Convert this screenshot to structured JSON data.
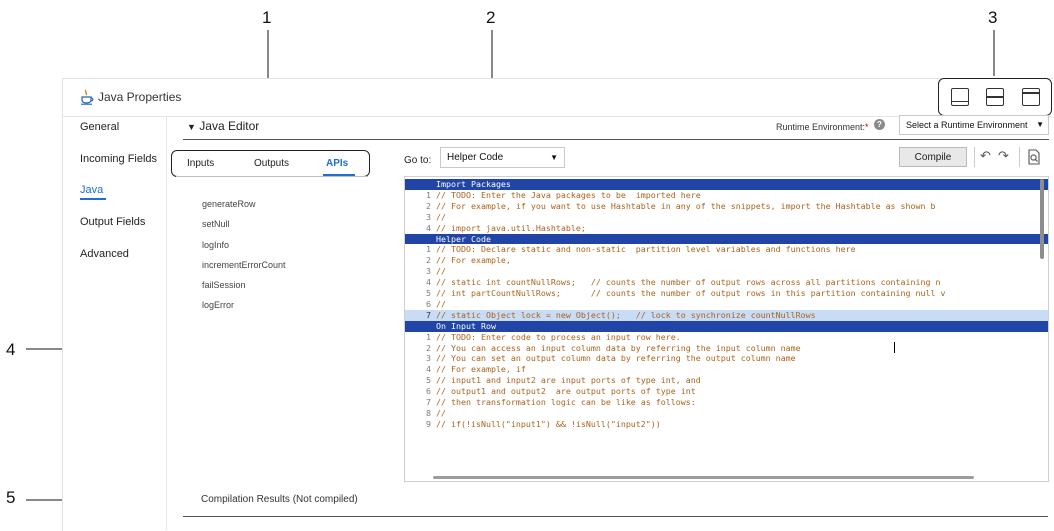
{
  "callouts": [
    "1",
    "2",
    "3",
    "4",
    "5"
  ],
  "window": {
    "title": "Java Properties",
    "icon": "java-cup-icon"
  },
  "layout_buttons": [
    "layout-bottom-icon",
    "layout-split-icon",
    "layout-top-icon"
  ],
  "sidebar": {
    "items": [
      {
        "label": "General",
        "active": false
      },
      {
        "label": "Incoming Fields",
        "active": false
      },
      {
        "label": "Java",
        "active": true
      },
      {
        "label": "Output Fields",
        "active": false
      },
      {
        "label": "Advanced",
        "active": false
      }
    ]
  },
  "editor_section": {
    "title": "Java Editor",
    "expanded_icon": "triangle-down-icon"
  },
  "runtime": {
    "label": "Runtime Environment:",
    "required_mark": "*",
    "select_value": "Select a Runtime Environment"
  },
  "tabs": [
    {
      "label": "Inputs",
      "active": false
    },
    {
      "label": "Outputs",
      "active": false
    },
    {
      "label": "APIs",
      "active": true
    }
  ],
  "api_items": [
    "generateRow",
    "setNull",
    "logInfo",
    "incrementErrorCount",
    "failSession",
    "logError"
  ],
  "goto": {
    "label": "Go to:",
    "value": "Helper Code"
  },
  "toolbar": {
    "compile_label": "Compile",
    "undo_icon": "undo-icon",
    "redo_icon": "redo-icon",
    "find_icon": "find-icon"
  },
  "code_lines": [
    {
      "n": "",
      "text": "Import Packages",
      "type": "hdr"
    },
    {
      "n": "1",
      "text": "// TODO: Enter the Java packages to be  imported here",
      "type": "code"
    },
    {
      "n": "2",
      "text": "// For example, if you want to use Hashtable in any of the snippets, import the Hashtable as shown b",
      "type": "code"
    },
    {
      "n": "3",
      "text": "//",
      "type": "code"
    },
    {
      "n": "4",
      "text": "// import java.util.Hashtable;",
      "type": "code"
    },
    {
      "n": "",
      "text": "Helper Code",
      "type": "hdr"
    },
    {
      "n": "1",
      "text": "// TODO: Declare static and non-static  partition level variables and functions here",
      "type": "code"
    },
    {
      "n": "2",
      "text": "// For example,",
      "type": "code"
    },
    {
      "n": "3",
      "text": "//",
      "type": "code"
    },
    {
      "n": "4",
      "text": "// static int countNullRows;   // counts the number of output rows across all partitions containing n",
      "type": "code"
    },
    {
      "n": "5",
      "text": "// int partCountNullRows;      // counts the number of output rows in this partition containing null v",
      "type": "code"
    },
    {
      "n": "6",
      "text": "//",
      "type": "code"
    },
    {
      "n": "7",
      "text": "// static Object lock = new Object();   // lock to synchronize countNullRows",
      "type": "sel"
    },
    {
      "n": "",
      "text": "On Input Row",
      "type": "hdr"
    },
    {
      "n": "1",
      "text": "// TODO: Enter code to process an input row here.",
      "type": "code"
    },
    {
      "n": "2",
      "text": "// You can access an input column data by referring the input column name",
      "type": "code"
    },
    {
      "n": "3",
      "text": "// You can set an output column data by referring the output column name",
      "type": "code"
    },
    {
      "n": "4",
      "text": "// For example, if",
      "type": "code"
    },
    {
      "n": "5",
      "text": "// input1 and input2 are input ports of type int, and",
      "type": "code"
    },
    {
      "n": "6",
      "text": "// output1 and output2  are output ports of type int",
      "type": "code"
    },
    {
      "n": "7",
      "text": "// then transformation logic can be like as follows:",
      "type": "code"
    },
    {
      "n": "8",
      "text": "//",
      "type": "code"
    },
    {
      "n": "9",
      "text": "// if(!isNull(\"input1\") && !isNull(\"input2\"))",
      "type": "code"
    }
  ],
  "compilation": {
    "label": "Compilation Results (Not compiled)",
    "icon": "triangle-right-icon"
  }
}
